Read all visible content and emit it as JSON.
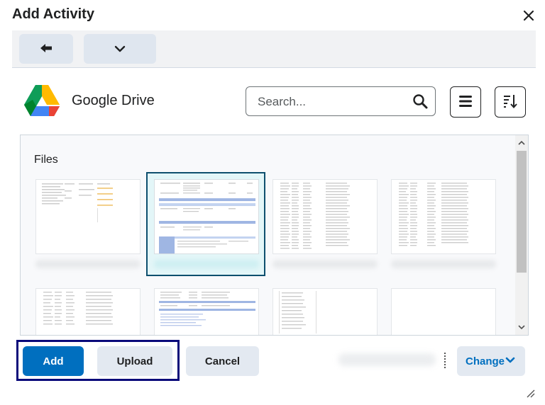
{
  "dialog": {
    "title": "Add Activity",
    "close_icon": "close-icon"
  },
  "toolbar": {
    "back_icon": "arrow-left-icon",
    "dropdown_icon": "chevron-down-icon"
  },
  "source": {
    "name": "Google Drive",
    "logo_icon": "google-drive-logo"
  },
  "search": {
    "placeholder": "Search...",
    "value": "",
    "icon": "search-icon"
  },
  "view_buttons": {
    "menu_icon": "hamburger-menu-icon",
    "sort_icon": "sort-icon"
  },
  "files": {
    "section_label": "Files",
    "thumbnails": [
      {
        "kind": "spreadsheet-wide",
        "selected": false
      },
      {
        "kind": "document-table",
        "selected": true
      },
      {
        "kind": "spreadsheet-list",
        "selected": false
      },
      {
        "kind": "spreadsheet-list",
        "selected": false
      },
      {
        "kind": "spreadsheet-list",
        "selected": false
      },
      {
        "kind": "document-table",
        "selected": false
      },
      {
        "kind": "list-short",
        "selected": false
      },
      {
        "kind": "blank",
        "selected": false
      }
    ]
  },
  "footer": {
    "add_label": "Add",
    "upload_label": "Upload",
    "cancel_label": "Cancel",
    "change_label": "Change"
  },
  "colors": {
    "primary": "#006fbf",
    "secondary_button": "#e3e9f1",
    "selected_outline": "#0e4f6e",
    "focus_outline": "#0a0a7a"
  }
}
